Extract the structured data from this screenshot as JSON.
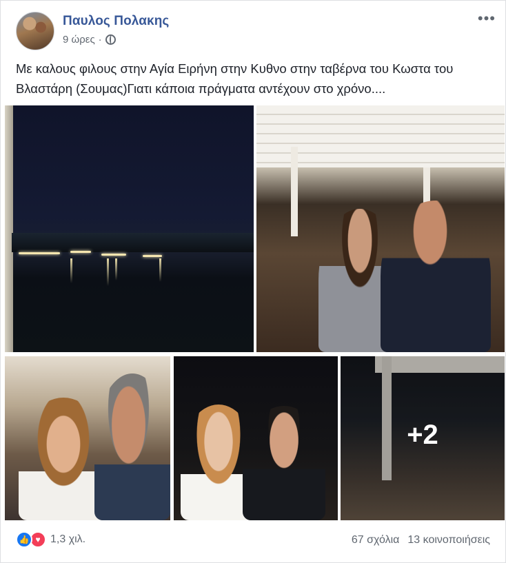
{
  "post": {
    "author": "Παυλος Πολακης",
    "time": "9 ώρες",
    "separator": "·",
    "privacy_icon": "globe-icon",
    "more_icon": "ellipsis-icon",
    "more_glyph": "•••",
    "text": "Με καλους φιλους στην Αγία Ειρήνη στην Κυθνο στην ταβέρνα του Κωστα του Βλαστάρη (Σουμας)Γιατι κάποια πράγματα αντέχουν στο χρόνο...."
  },
  "photos": {
    "extra_count": "+2"
  },
  "reactions": {
    "icons": [
      "like-icon",
      "love-icon"
    ],
    "like_glyph": "👍",
    "love_glyph": "♥",
    "count": "1,3 χιλ."
  },
  "stats": {
    "comments": "67 σχόλια",
    "shares": "13 κοινοποιήσεις"
  },
  "colors": {
    "author_link": "#385898",
    "meta_text": "#606770",
    "like_blue": "#1877f2",
    "love_red": "#f33e58"
  }
}
